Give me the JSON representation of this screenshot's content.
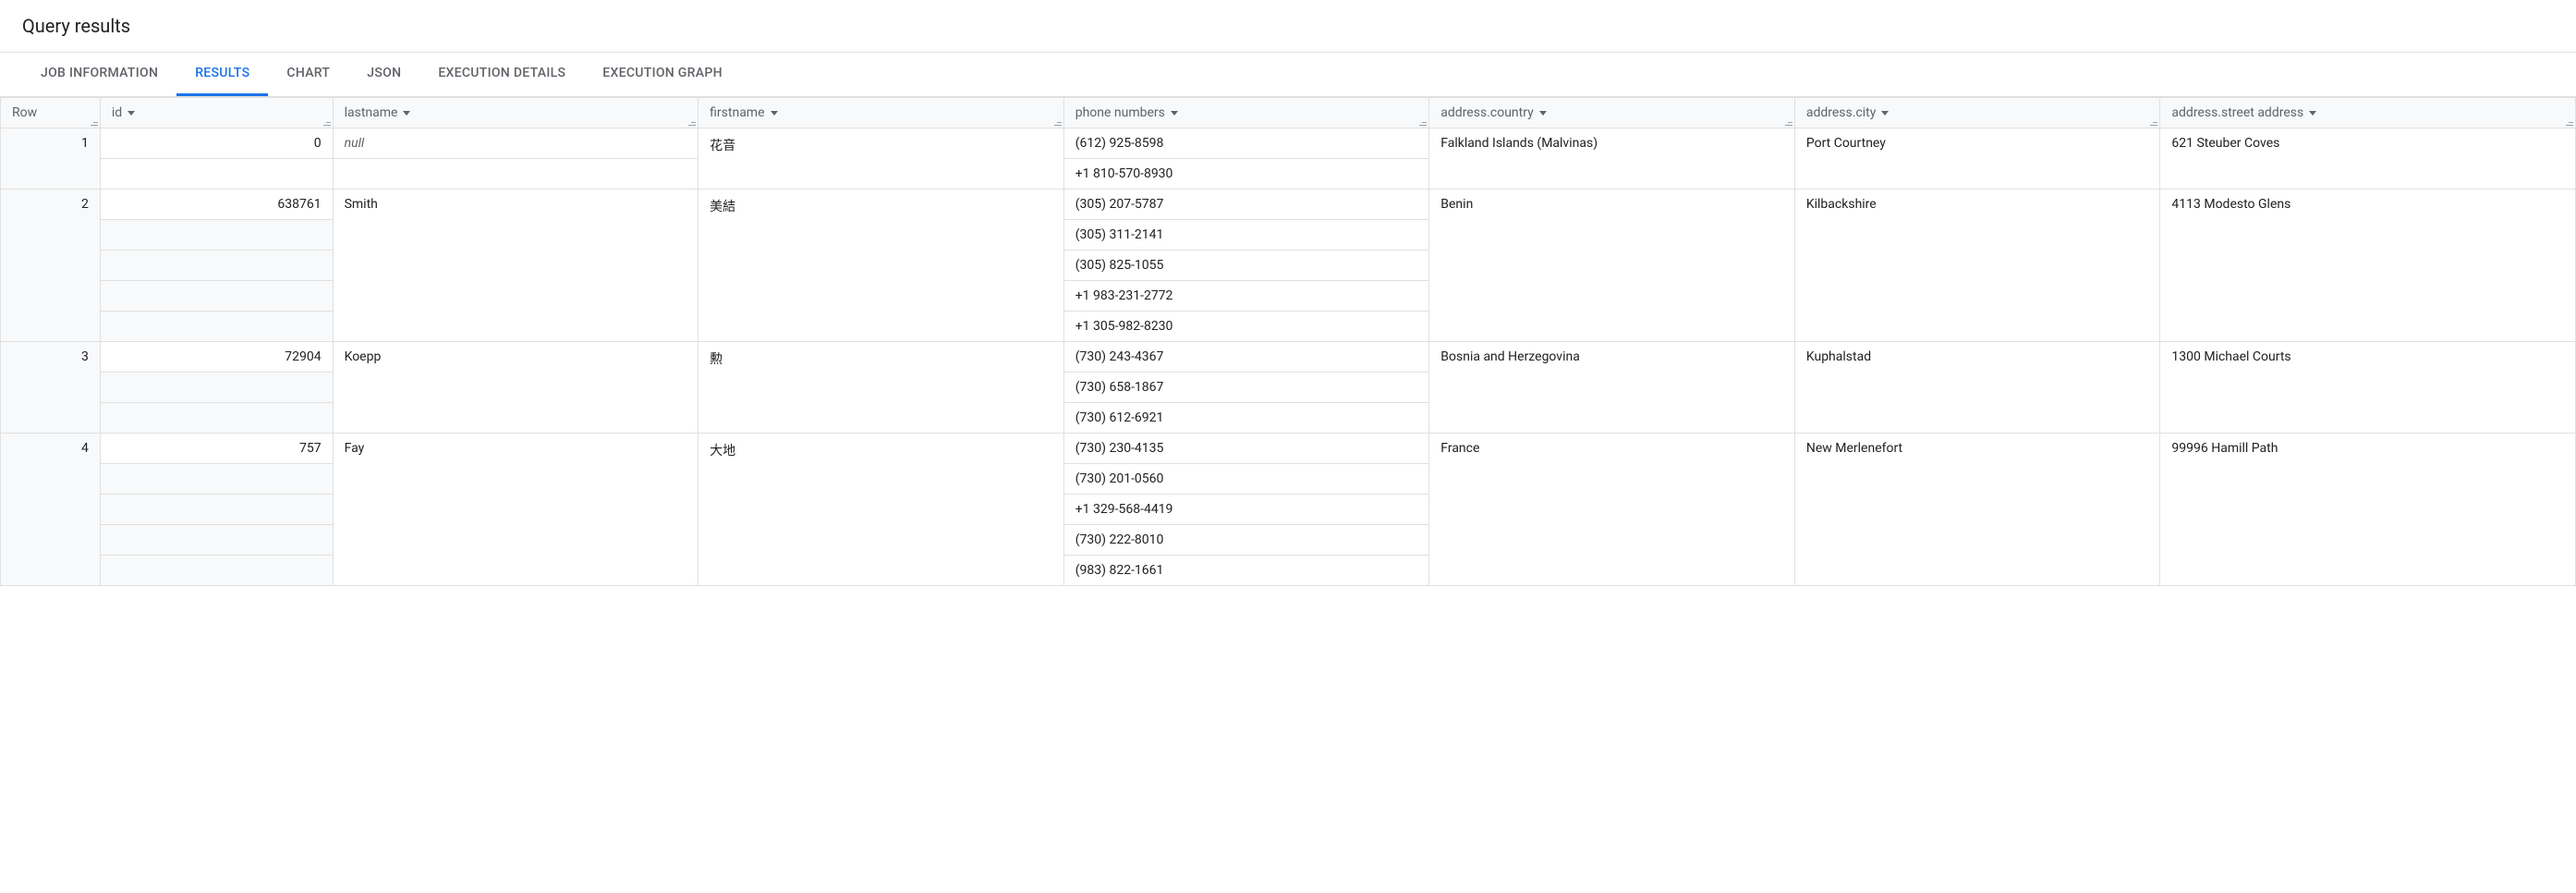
{
  "title": "Query results",
  "tabs": [
    {
      "label": "JOB INFORMATION",
      "active": false
    },
    {
      "label": "RESULTS",
      "active": true
    },
    {
      "label": "CHART",
      "active": false
    },
    {
      "label": "JSON",
      "active": false
    },
    {
      "label": "EXECUTION DETAILS",
      "active": false
    },
    {
      "label": "EXECUTION GRAPH",
      "active": false
    }
  ],
  "columns": {
    "row": "Row",
    "id": "id",
    "lastname": "lastname",
    "firstname": "firstname",
    "phone": "phone numbers",
    "country_prefix": "address.",
    "country": "country",
    "city_prefix": "address.",
    "city": "city",
    "street_prefix": "address.",
    "street": "street address"
  },
  "rows": [
    {
      "row": "1",
      "id": "0",
      "lastname_null": "null",
      "firstname": "花音",
      "phones": [
        "(612) 925-8598",
        "+1 810-570-8930"
      ],
      "country": "Falkland Islands (Malvinas)",
      "city": "Port Courtney",
      "street": "621 Steuber Coves"
    },
    {
      "row": "2",
      "id": "638761",
      "lastname": "Smith",
      "firstname": "美結",
      "phones": [
        "(305) 207-5787",
        "(305) 311-2141",
        "(305) 825-1055",
        "+1 983-231-2772",
        "+1 305-982-8230"
      ],
      "country": "Benin",
      "city": "Kilbackshire",
      "street": "4113 Modesto Glens"
    },
    {
      "row": "3",
      "id": "72904",
      "lastname": "Koepp",
      "firstname": "勲",
      "phones": [
        "(730) 243-4367",
        "(730) 658-1867",
        "(730) 612-6921"
      ],
      "country": "Bosnia and Herzegovina",
      "city": "Kuphalstad",
      "street": "1300 Michael Courts"
    },
    {
      "row": "4",
      "id": "757",
      "lastname": "Fay",
      "firstname": "大地",
      "phones": [
        "(730) 230-4135",
        "(730) 201-0560",
        "+1 329-568-4419",
        "(730) 222-8010",
        "(983) 822-1661"
      ],
      "country": "France",
      "city": "New Merlenefort",
      "street": "99996 Hamill Path"
    }
  ]
}
